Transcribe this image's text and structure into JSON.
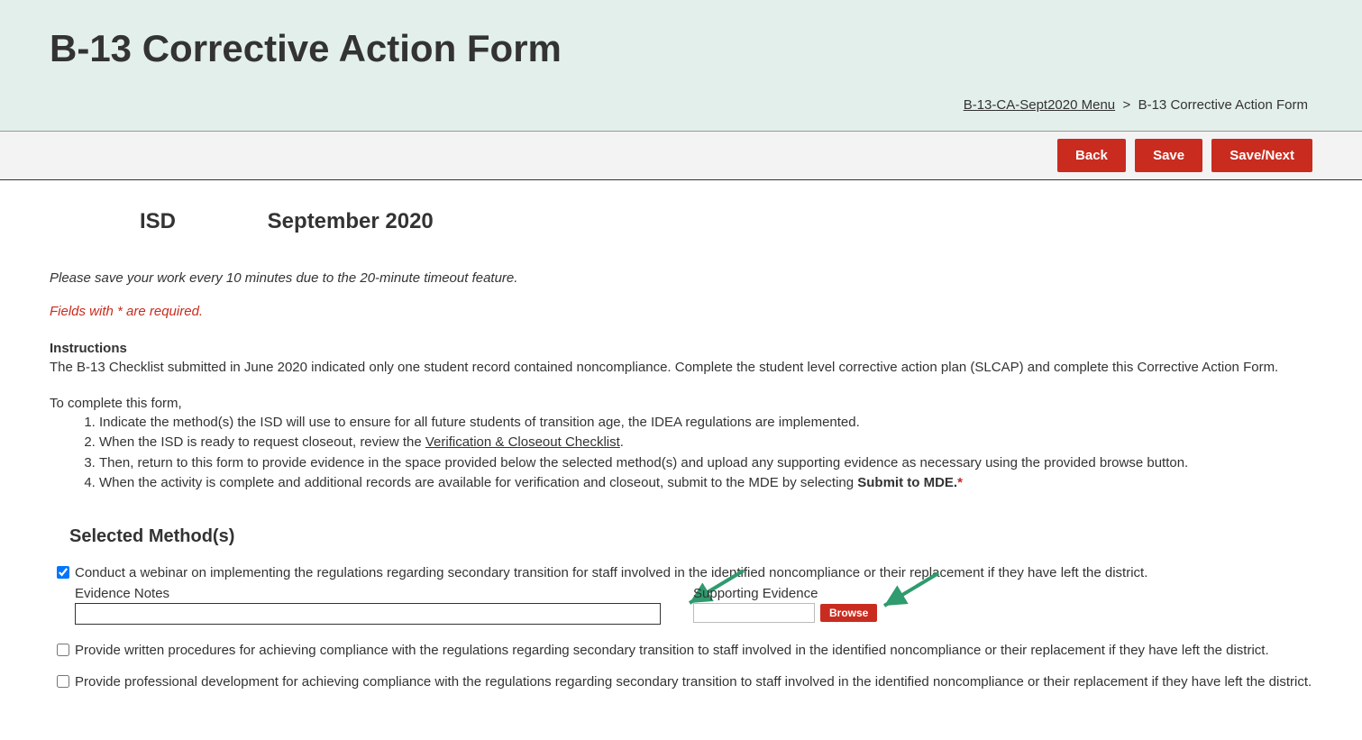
{
  "header": {
    "title": "B-13 Corrective Action Form"
  },
  "breadcrumb": {
    "link_label": "B-13-CA-Sept2020 Menu",
    "separator": ">",
    "current": "B-13 Corrective Action Form"
  },
  "toolbar": {
    "back": "Back",
    "save": "Save",
    "save_next": "Save/Next"
  },
  "subheader": {
    "isd": "ISD",
    "period": "September 2020"
  },
  "notes": {
    "save_reminder": "Please save your work every 10 minutes due to the 20-minute timeout feature.",
    "required": "Fields with * are required."
  },
  "instructions": {
    "title": "Instructions",
    "body": "The B-13 Checklist submitted in June 2020 indicated only one student record contained noncompliance. Complete the student level corrective action plan (SLCAP) and complete this Corrective Action Form.",
    "lead": "To complete this form,",
    "steps": {
      "s1": "Indicate the method(s) the ISD will use to ensure for all future students of transition age, the IDEA regulations are implemented.",
      "s2_pre": "When the ISD is ready to request closeout, review the ",
      "s2_link": "Verification & Closeout Checklist",
      "s2_post": ".",
      "s3": "Then, return to this form to provide evidence in the space provided below the selected method(s) and upload any supporting evidence as necessary using the provided browse button.",
      "s4_pre": "When the activity is complete and additional records are available for verification and closeout, submit to the MDE by selecting ",
      "s4_bold": "Submit to MDE.",
      "s4_star": "*"
    }
  },
  "methods": {
    "section_title": "Selected Method(s)",
    "m1": {
      "label": "Conduct a webinar on implementing the regulations regarding secondary transition for staff involved in the identified noncompliance or their replacement if they have left the district.",
      "evidence_notes_label": "Evidence Notes",
      "supporting_evidence_label": "Supporting Evidence",
      "browse": "Browse"
    },
    "m2": {
      "label": "Provide written procedures for achieving compliance with the regulations regarding secondary transition to staff involved in the identified noncompliance or their replacement if they have left the district."
    },
    "m3": {
      "label": "Provide professional development for achieving compliance with the regulations regarding secondary transition to staff involved in the identified noncompliance or their replacement if they have left the district."
    }
  }
}
